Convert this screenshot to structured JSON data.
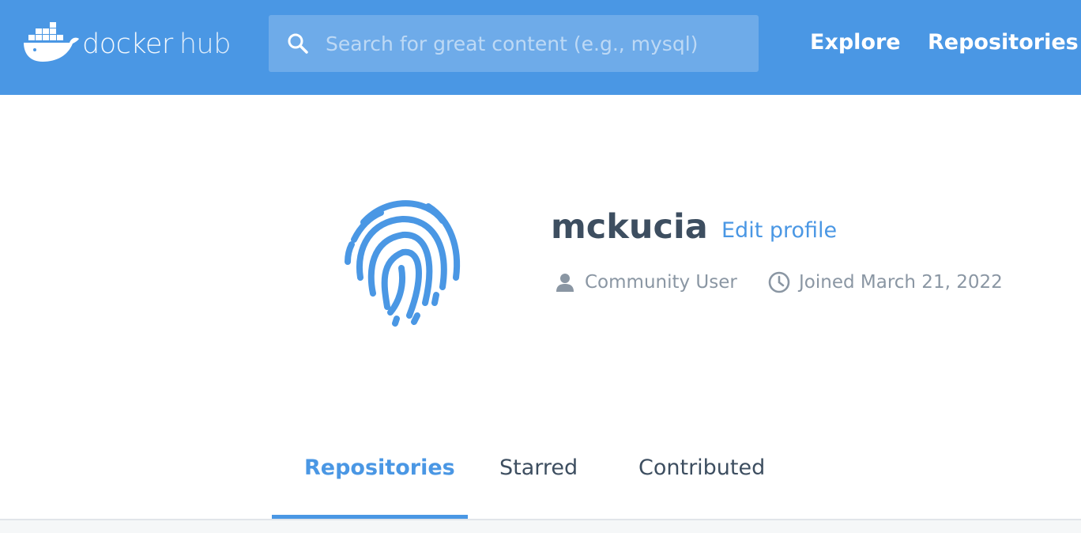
{
  "header": {
    "logo": {
      "text_primary": "docker",
      "text_secondary": "hub",
      "icon": "docker-whale-icon"
    },
    "search": {
      "placeholder": "Search for great content (e.g., mysql)",
      "value": "",
      "icon": "search-icon"
    },
    "nav": {
      "explore": "Explore",
      "repositories": "Repositories"
    },
    "background_color": "#4a97e4"
  },
  "profile": {
    "avatar_icon": "fingerprint-icon",
    "username": "mckucia",
    "edit_profile": "Edit profile",
    "user_type": {
      "icon": "user-icon",
      "label": "Community User"
    },
    "joined": {
      "icon": "clock-icon",
      "label": "Joined March 21, 2022"
    }
  },
  "tabs": {
    "items": [
      {
        "label": "Repositories",
        "active": true
      },
      {
        "label": "Starred",
        "active": false
      },
      {
        "label": "Contributed",
        "active": false
      }
    ],
    "active_color": "#4a97e4"
  }
}
